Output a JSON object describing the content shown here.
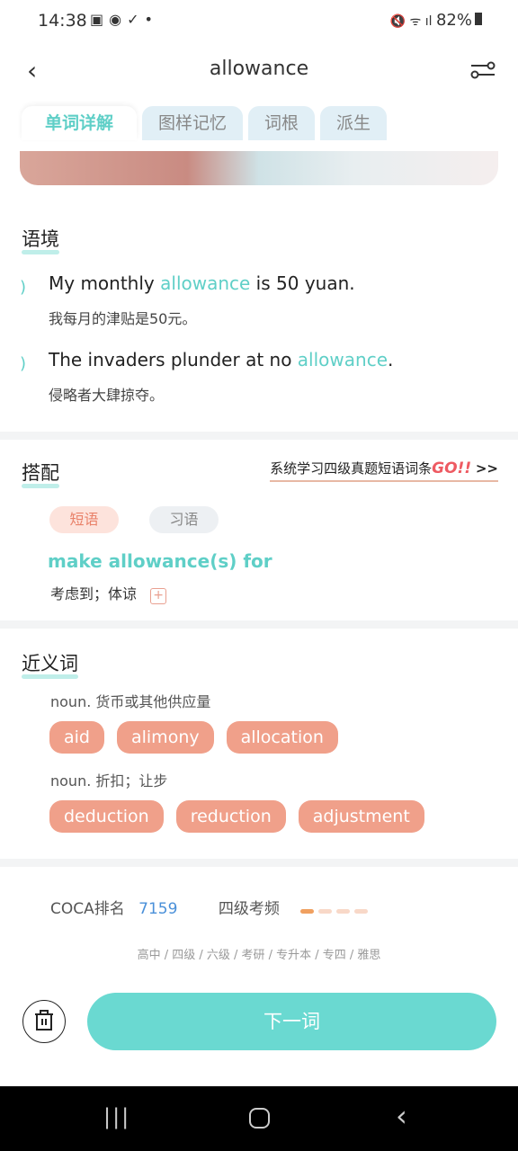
{
  "status_bar": {
    "time": "14:38",
    "battery": "82%"
  },
  "header": {
    "title": "allowance"
  },
  "tabs": [
    {
      "label": "单词详解",
      "active": true
    },
    {
      "label": "图样记忆"
    },
    {
      "label": "词根"
    },
    {
      "label": "派生"
    }
  ],
  "context": {
    "title": "语境",
    "examples": [
      {
        "pre": "My monthly ",
        "word": "allowance",
        "post": " is 50 yuan.",
        "zh": "我每月的津贴是50元。"
      },
      {
        "pre": "The invaders plunder at no ",
        "word": "allowance",
        "post": ".",
        "zh": "侵略者大肆掠夺。"
      }
    ]
  },
  "collocation": {
    "title": "搭配",
    "promo_text": "系统学习四级真题短语词条",
    "promo_go": "GO!!",
    "promo_arrow": ">>",
    "tab_phrase": "短语",
    "tab_idiom": "习语",
    "phrase": "make allowance(s) for",
    "meaning": "考虑到；体谅",
    "add_icon": "plus-square-icon"
  },
  "synonyms": {
    "title": "近义词",
    "groups": [
      {
        "pos": "noun. 货币或其他供应量",
        "words": [
          "aid",
          "alimony",
          "allocation"
        ]
      },
      {
        "pos": "noun. 折扣；让步",
        "words": [
          "deduction",
          "reduction",
          "adjustment"
        ]
      }
    ]
  },
  "stats": {
    "coca_label": "COCA排名",
    "coca_value": "7159",
    "freq_label": "四级考频",
    "freq_level": 1,
    "freq_max": 4,
    "levels": "高中 / 四级 / 六级 / 考研 / 专升本 / 专四 / 雅思"
  },
  "bottom": {
    "next_label": "下一词"
  },
  "colors": {
    "accent": "#5fcfc7",
    "chip": "#f0a08a",
    "freq_on": "#f0a060",
    "freq_off": "#f8d8c8"
  }
}
